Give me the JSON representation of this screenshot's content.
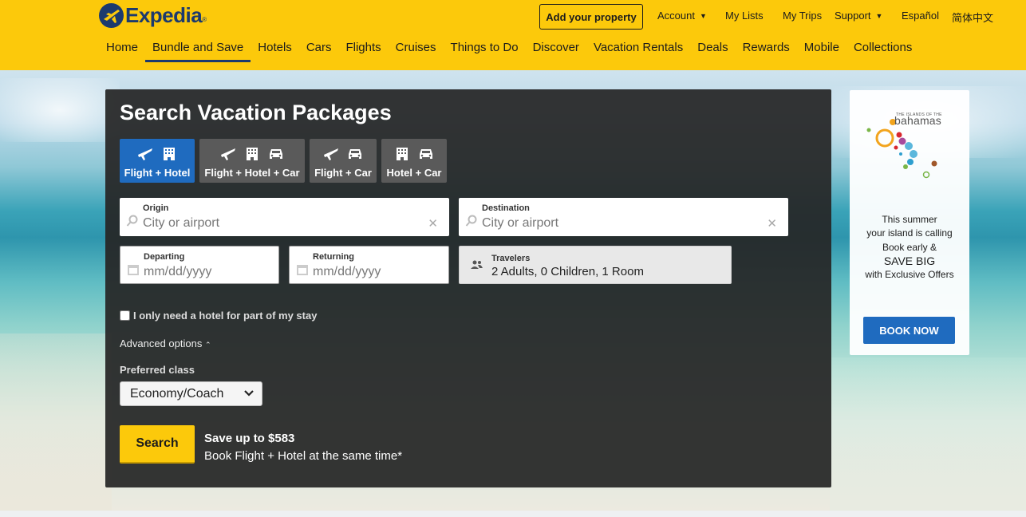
{
  "header": {
    "logo_text": "Expedia",
    "logo_tm": "®",
    "add_property": "Add your property",
    "account": "Account",
    "my_lists": "My Lists",
    "my_trips": "My Trips",
    "support": "Support",
    "espanol": "Español",
    "chinese": "简体中文"
  },
  "nav": [
    "Home",
    "Bundle and Save",
    "Hotels",
    "Cars",
    "Flights",
    "Cruises",
    "Things to Do",
    "Discover",
    "Vacation Rentals",
    "Deals",
    "Rewards",
    "Mobile",
    "Collections"
  ],
  "nav_active": "Bundle and Save",
  "search": {
    "title": "Search Vacation Packages",
    "tabs": [
      {
        "label": "Flight + Hotel",
        "icons": [
          "plane-icon",
          "hotel-icon"
        ]
      },
      {
        "label": "Flight + Hotel + Car",
        "icons": [
          "plane-icon",
          "hotel-icon",
          "car-icon"
        ]
      },
      {
        "label": "Flight + Car",
        "icons": [
          "plane-icon",
          "car-icon"
        ]
      },
      {
        "label": "Hotel + Car",
        "icons": [
          "hotel-icon",
          "car-icon"
        ]
      }
    ],
    "active_tab": "Flight + Hotel",
    "origin_label": "Origin",
    "origin_placeholder": "City or airport",
    "destination_label": "Destination",
    "destination_placeholder": "City or airport",
    "departing_label": "Departing",
    "departing_placeholder": "mm/dd/yyyy",
    "returning_label": "Returning",
    "returning_placeholder": "mm/dd/yyyy",
    "travelers_label": "Travelers",
    "travelers_value": "2 Adults, 0 Children, 1 Room",
    "partial_hotel": "I only need a hotel for part of my stay",
    "advanced": "Advanced options",
    "preferred_class_label": "Preferred class",
    "preferred_class_value": "Economy/Coach",
    "search_button": "Search",
    "save_headline": "Save up to $583",
    "save_sub": "Book Flight + Hotel at the same time*"
  },
  "ad": {
    "brand_small": "THE ISLANDS OF THE",
    "brand": "bahamas",
    "line1": "This summer",
    "line2": "your island is calling",
    "line3": "Book early &",
    "line4": "SAVE BIG",
    "line5": "with Exclusive Offers",
    "book_now": "BOOK NOW"
  },
  "colors": {
    "brand_yellow": "#fcc90b",
    "brand_navy": "#1c3a6e",
    "active_tab_blue": "#1f6bbf"
  }
}
